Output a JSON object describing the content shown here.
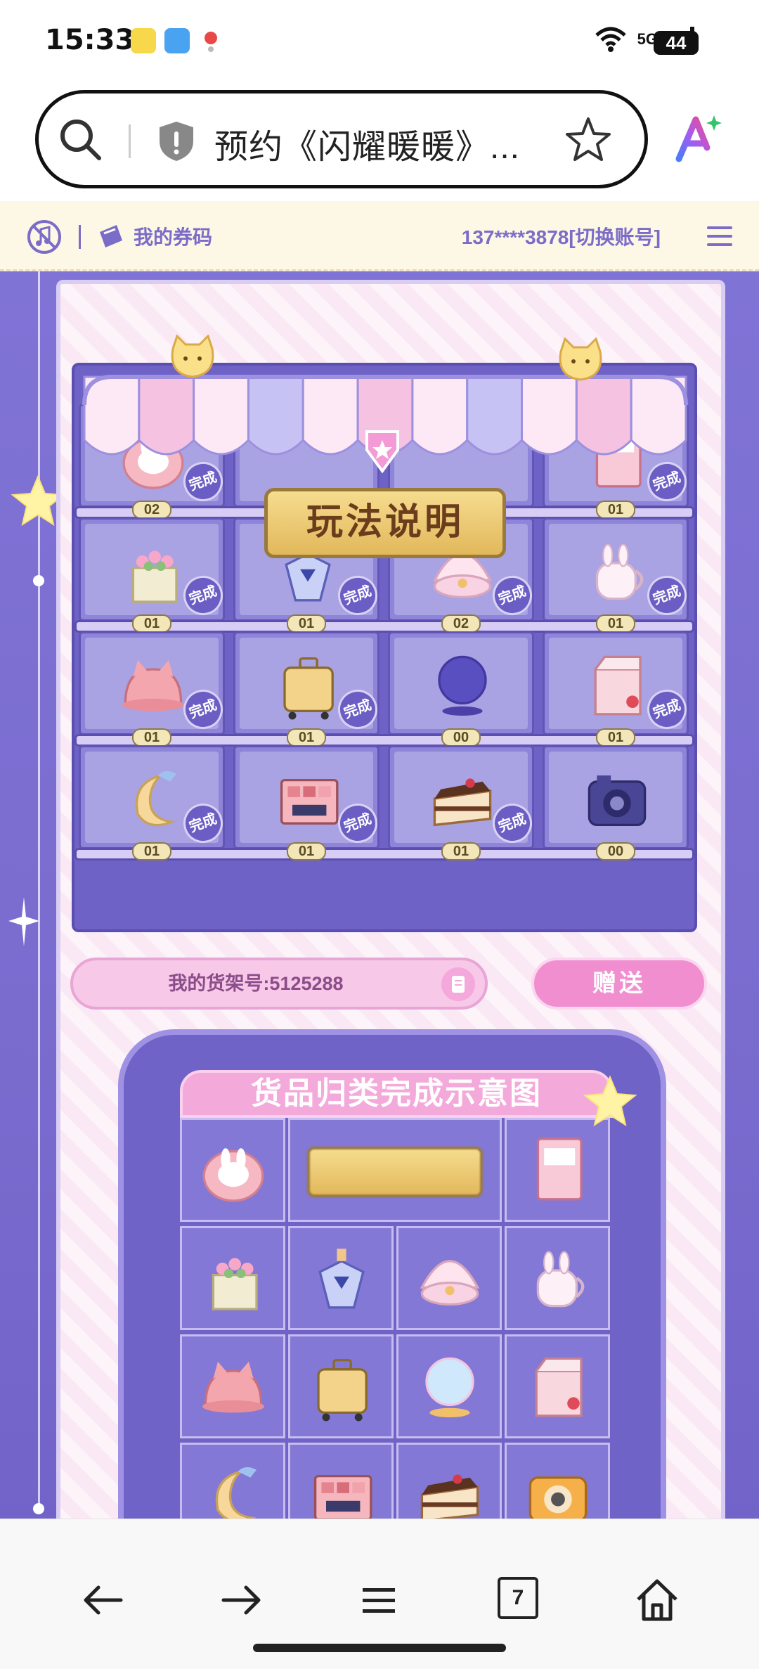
{
  "status_bar": {
    "time": "15:33",
    "network": "5G",
    "battery": "44",
    "icons": [
      "app-notification-icon",
      "weather-icon",
      "location-icon",
      "wifi-icon",
      "signal-icon"
    ]
  },
  "browser": {
    "url_title": "预约《闪耀暖暖》...",
    "icons": [
      "search-icon",
      "shield-icon",
      "star-icon",
      "ai-assistant-icon"
    ]
  },
  "game_bar": {
    "voucher_label": "我的券码",
    "account": "137****3878[切换账号]",
    "icons": [
      "music-off-icon",
      "ticket-icon",
      "menu-icon"
    ]
  },
  "shelf": {
    "rules_label": "玩法说明",
    "badge_label": "完成",
    "rows": [
      [
        {
          "item": "bunny-backpack",
          "count": "02",
          "done": true
        },
        {
          "item": "rules-sign",
          "count": "",
          "done": false
        },
        {
          "item": "rules-sign",
          "count": "",
          "done": false
        },
        {
          "item": "photo-album",
          "count": "01",
          "done": true
        }
      ],
      [
        {
          "item": "flower-basket",
          "count": "01",
          "done": true
        },
        {
          "item": "perfume-bottle",
          "count": "01",
          "done": true
        },
        {
          "item": "shell-ring",
          "count": "02",
          "done": true
        },
        {
          "item": "bunny-mug",
          "count": "01",
          "done": true
        }
      ],
      [
        {
          "item": "cat-hat",
          "count": "01",
          "done": true
        },
        {
          "item": "suitcase",
          "count": "01",
          "done": true
        },
        {
          "item": "crystal-ball",
          "count": "00",
          "done": false
        },
        {
          "item": "milk-carton",
          "count": "01",
          "done": true
        }
      ],
      [
        {
          "item": "moon-pillow",
          "count": "01",
          "done": true
        },
        {
          "item": "makeup-palette",
          "count": "01",
          "done": true
        },
        {
          "item": "cake-slice",
          "count": "01",
          "done": true
        },
        {
          "item": "camera",
          "count": "00",
          "done": false
        }
      ]
    ]
  },
  "actions": {
    "shelf_number": "我的货架号:5125288",
    "gift_label": "赠送"
  },
  "diagram": {
    "title": "货品归类完成示意图"
  },
  "nav": {
    "tabs_count": "7",
    "icons": [
      "back-arrow-icon",
      "forward-arrow-icon",
      "menu-icon",
      "tabs-icon",
      "home-icon"
    ]
  },
  "colors": {
    "accent_purple": "#7b6cc7",
    "pink": "#f08ed0",
    "background_purple": "#7a6ccf"
  }
}
